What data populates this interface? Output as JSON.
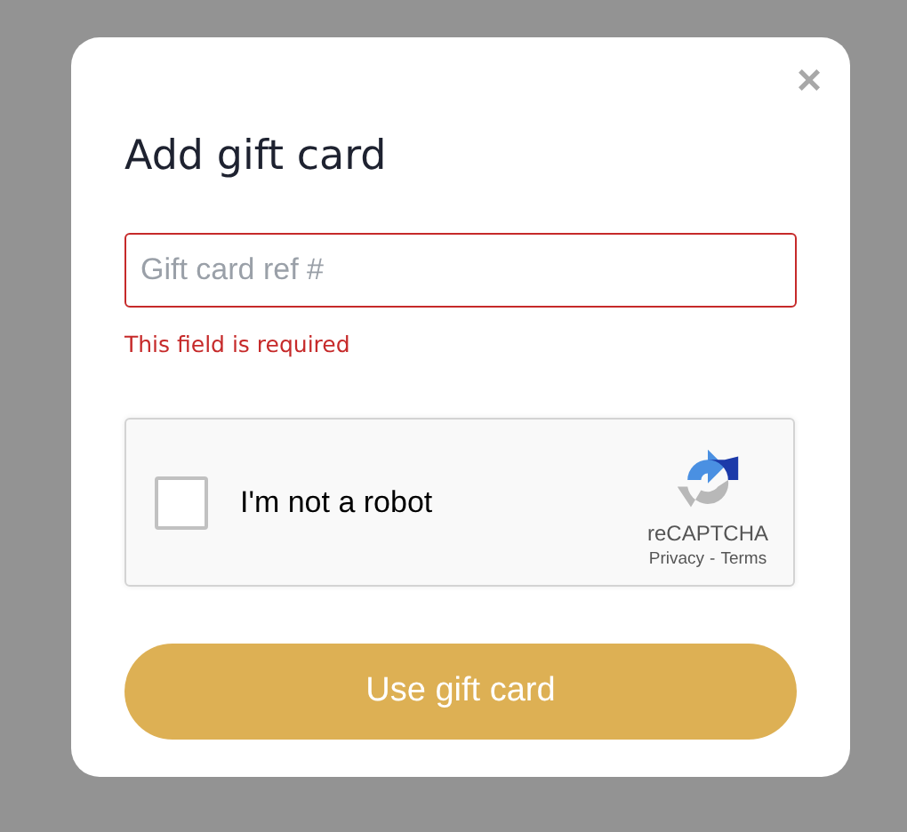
{
  "dialog": {
    "title": "Add gift card",
    "close": "×"
  },
  "field": {
    "placeholder": "Gift card ref #",
    "invalid": true,
    "error": "This field is required"
  },
  "captcha": {
    "label": "I'm not a robot",
    "checked": false,
    "brand": "reCAPTCHA",
    "privacy": "Privacy",
    "separator": "-",
    "terms": "Terms"
  },
  "submit": "Use gift card"
}
